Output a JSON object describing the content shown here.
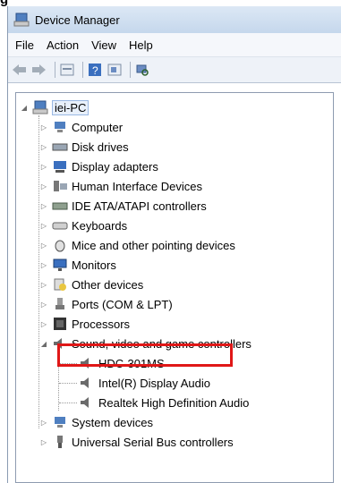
{
  "window": {
    "title": "Device Manager"
  },
  "menu": [
    "File",
    "Action",
    "View",
    "Help"
  ],
  "tree": {
    "root": "iei-PC",
    "categories": [
      "Computer",
      "Disk drives",
      "Display adapters",
      "Human Interface Devices",
      "IDE ATA/ATAPI controllers",
      "Keyboards",
      "Mice and other pointing devices",
      "Monitors",
      "Other devices",
      "Ports (COM & LPT)",
      "Processors",
      "Sound, video and game controllers",
      "System devices",
      "Universal Serial Bus controllers"
    ],
    "sound_children": [
      "HDC-301MS",
      "Intel(R) Display Audio",
      "Realtek High Definition Audio"
    ]
  },
  "colors": {
    "highlight_box": "#e01717"
  }
}
